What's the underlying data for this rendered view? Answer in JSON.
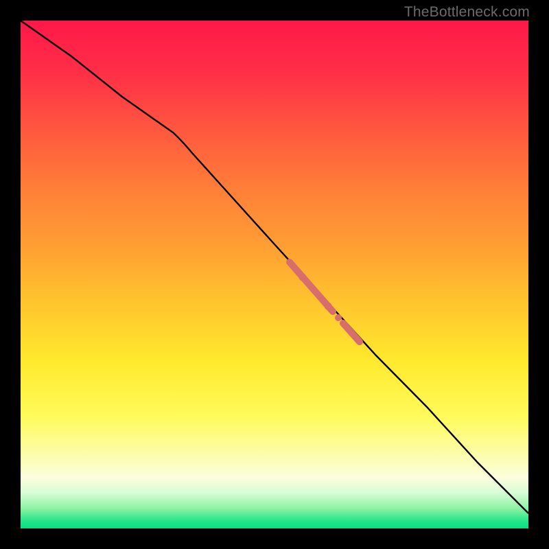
{
  "watermark": "TheBottleneck.com",
  "colors": {
    "black": "#000000",
    "line": "#000000",
    "marker": "#d86e6c",
    "gradient_stops": [
      "#ff1848",
      "#ff2e47",
      "#ff593f",
      "#ff7e38",
      "#ffa033",
      "#ffc32e",
      "#ffe92d",
      "#fffb5a",
      "#fbfedc",
      "#d8fdd6",
      "#8ef3a4",
      "#26e58a",
      "#07de7e"
    ]
  },
  "chart_data": {
    "type": "line",
    "title": "",
    "xlabel": "",
    "ylabel": "",
    "xlim": [
      0,
      1
    ],
    "ylim": [
      0,
      1
    ],
    "grid": false,
    "legend": false,
    "series": [
      {
        "name": "curve",
        "x": [
          0.0,
          0.1,
          0.2,
          0.3,
          0.4,
          0.5,
          0.6,
          0.7,
          0.8,
          0.9,
          1.0
        ],
        "y": [
          1.0,
          0.93,
          0.85,
          0.78,
          0.67,
          0.56,
          0.45,
          0.34,
          0.24,
          0.13,
          0.03
        ]
      }
    ],
    "markers": [
      {
        "cx": 0.555,
        "cy": 0.495,
        "r": 0.0075
      },
      {
        "cx": 0.605,
        "cy": 0.438,
        "r": 0.0075
      },
      {
        "cx": 0.64,
        "cy": 0.399,
        "r": 0.0075
      }
    ],
    "thick_segments": [
      {
        "x0": 0.53,
        "y0": 0.524,
        "x1": 0.615,
        "y1": 0.427
      },
      {
        "x0": 0.636,
        "y0": 0.404,
        "x1": 0.668,
        "y1": 0.368
      }
    ]
  }
}
